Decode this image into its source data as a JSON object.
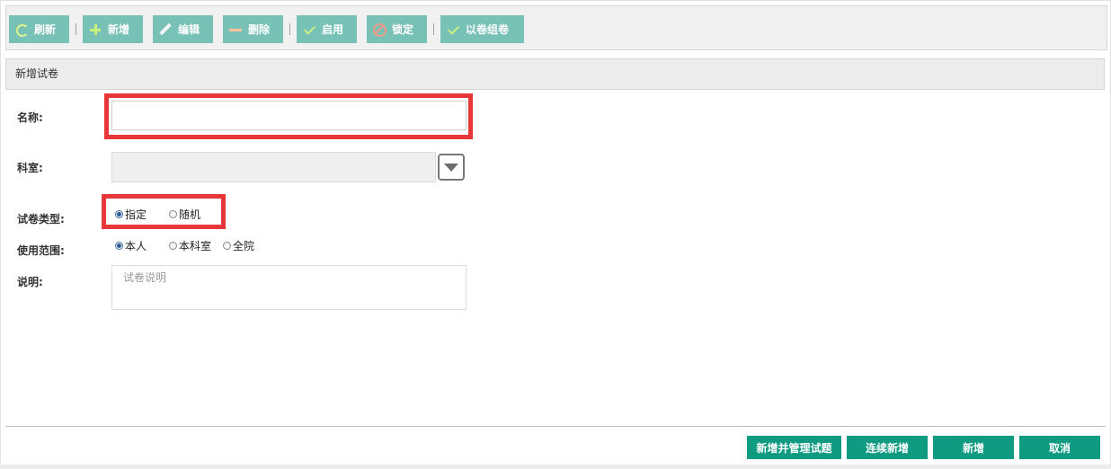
{
  "toolbar": {
    "refresh": "刷新",
    "add": "新增",
    "edit": "编辑",
    "delete": "删除",
    "enable": "启用",
    "lock": "锁定",
    "compose": "以卷组卷"
  },
  "section_title": "新增试卷",
  "form": {
    "name_label": "名称:",
    "name_value": "",
    "dept_label": "科室:",
    "dept_value": "",
    "type_label": "试卷类型:",
    "type_options": [
      "指定",
      "随机"
    ],
    "type_selected": "指定",
    "scope_label": "使用范围:",
    "scope_options": [
      "本人",
      "本科室",
      "全院"
    ],
    "scope_selected": "本人",
    "desc_label": "说明:",
    "desc_placeholder": "试卷说明"
  },
  "footer": {
    "add_and_manage": "新增并管理试题",
    "continue_add": "连续新增",
    "add": "新增",
    "cancel": "取消"
  },
  "colors": {
    "toolbar_button": "#78c1b7",
    "primary_button": "#0f9a82",
    "highlight": "#e8373b"
  }
}
